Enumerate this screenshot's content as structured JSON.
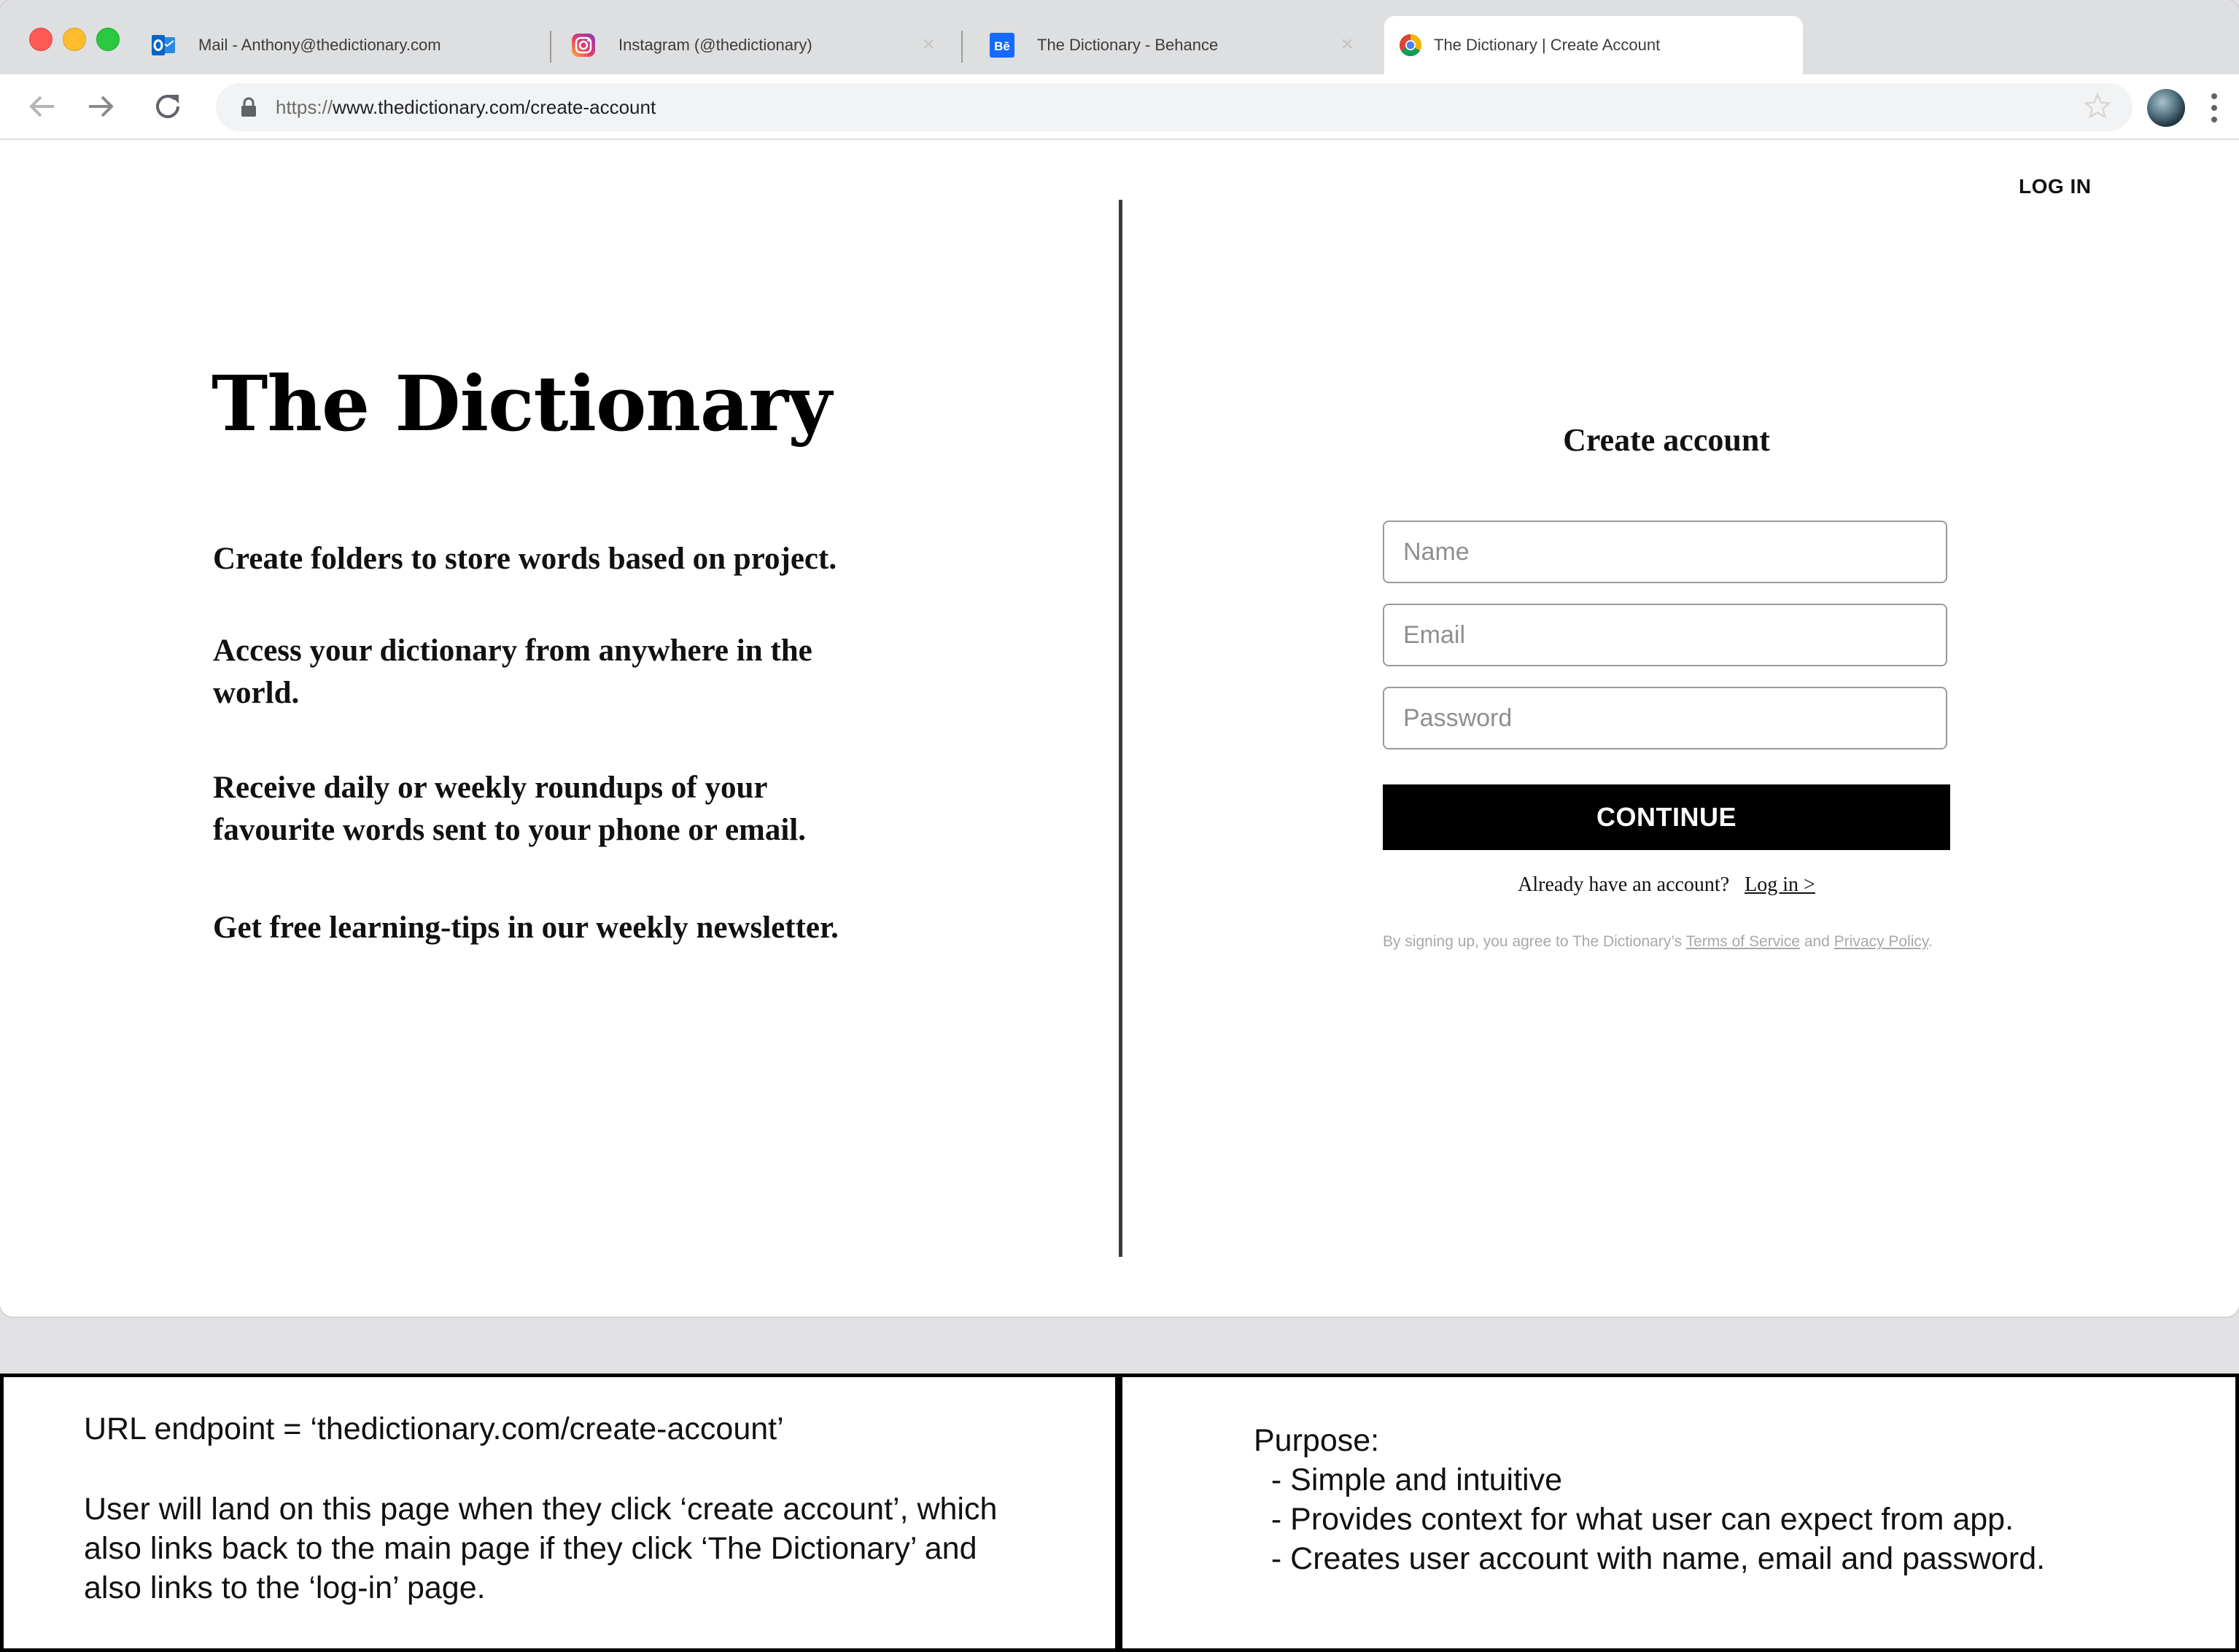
{
  "browser": {
    "tabs": [
      {
        "title": "Mail - Anthony@thedictionary.com",
        "icon": "outlook-icon",
        "active": false
      },
      {
        "title": "Instagram (@thedictionary)",
        "icon": "instagram-icon",
        "active": false
      },
      {
        "title": "The Dictionary - Behance",
        "icon": "behance-icon",
        "active": false
      },
      {
        "title": "The Dictionary | Create Account",
        "icon": "chrome-icon",
        "active": true
      }
    ],
    "tab_close_glyph": "×",
    "url_scheme": "https://",
    "url_rest": "www.thedictionary.com/create-account"
  },
  "header": {
    "login_label": "LOG IN"
  },
  "left": {
    "brand": "The Dictionary",
    "features": [
      "Create folders to store words based on project.",
      "Access your dictionary from anywhere in the world.",
      "Receive daily or weekly roundups of  your favourite words sent to your phone or email.",
      "Get free learning-tips in our weekly newsletter."
    ]
  },
  "form": {
    "title": "Create account",
    "name_placeholder": "Name",
    "email_placeholder": "Email",
    "password_placeholder": "Password",
    "continue_label": "CONTINUE",
    "already_text": "Already have an account?",
    "login_link": "Log in >",
    "terms_prefix": "By signing up, you agree to The Dictionary’s",
    "terms_link": "Terms of Service",
    "terms_and": "and",
    "privacy_link": "Privacy Policy",
    "terms_suffix": "."
  },
  "notes": {
    "left_line1": "URL endpoint = ‘thedictionary.com/create-account’",
    "left_paragraph": "User will land on this page when they click ‘create account’, which also links back to the main page if they click ‘The Dictionary’ and also links to the ‘log-in’ page.",
    "right_heading": "Purpose:",
    "right_items": [
      "  - Simple and intuitive",
      "  - Provides context for what user can expect from app.",
      "  - Creates user account with name, email and password."
    ]
  },
  "colors": {
    "tab_strip": "#dedfe1",
    "button_black": "#000000",
    "outlook_blue": "#0a64c8",
    "behance_blue": "#1769ff"
  }
}
